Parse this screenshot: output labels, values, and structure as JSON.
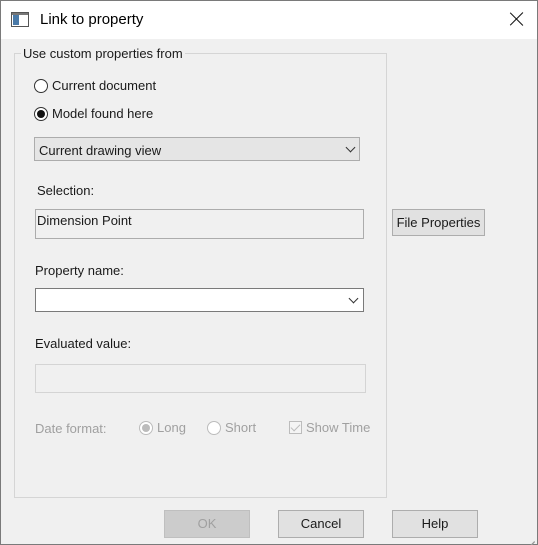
{
  "window": {
    "title": "Link to property"
  },
  "group": {
    "legend": "Use custom properties from"
  },
  "source": {
    "options": [
      {
        "label": "Current document",
        "checked": false
      },
      {
        "label": "Model found here",
        "checked": true
      }
    ],
    "model_select_value": "Current drawing view"
  },
  "selection": {
    "label": "Selection:",
    "value": "Dimension Point"
  },
  "file_properties_button": "File Properties",
  "property_name": {
    "label": "Property name:",
    "value": ""
  },
  "evaluated_value": {
    "label": "Evaluated value:",
    "value": ""
  },
  "date_format": {
    "label": "Date format:",
    "long_label": "Long",
    "short_label": "Short",
    "selected": "Long",
    "show_time_label": "Show Time",
    "show_time_checked": true
  },
  "buttons": {
    "ok": "OK",
    "cancel": "Cancel",
    "help": "Help"
  },
  "icons": {
    "app": "window-icon",
    "close": "close-icon",
    "dropdown": "chevron-down-icon",
    "resize": "resize-grip-icon"
  }
}
